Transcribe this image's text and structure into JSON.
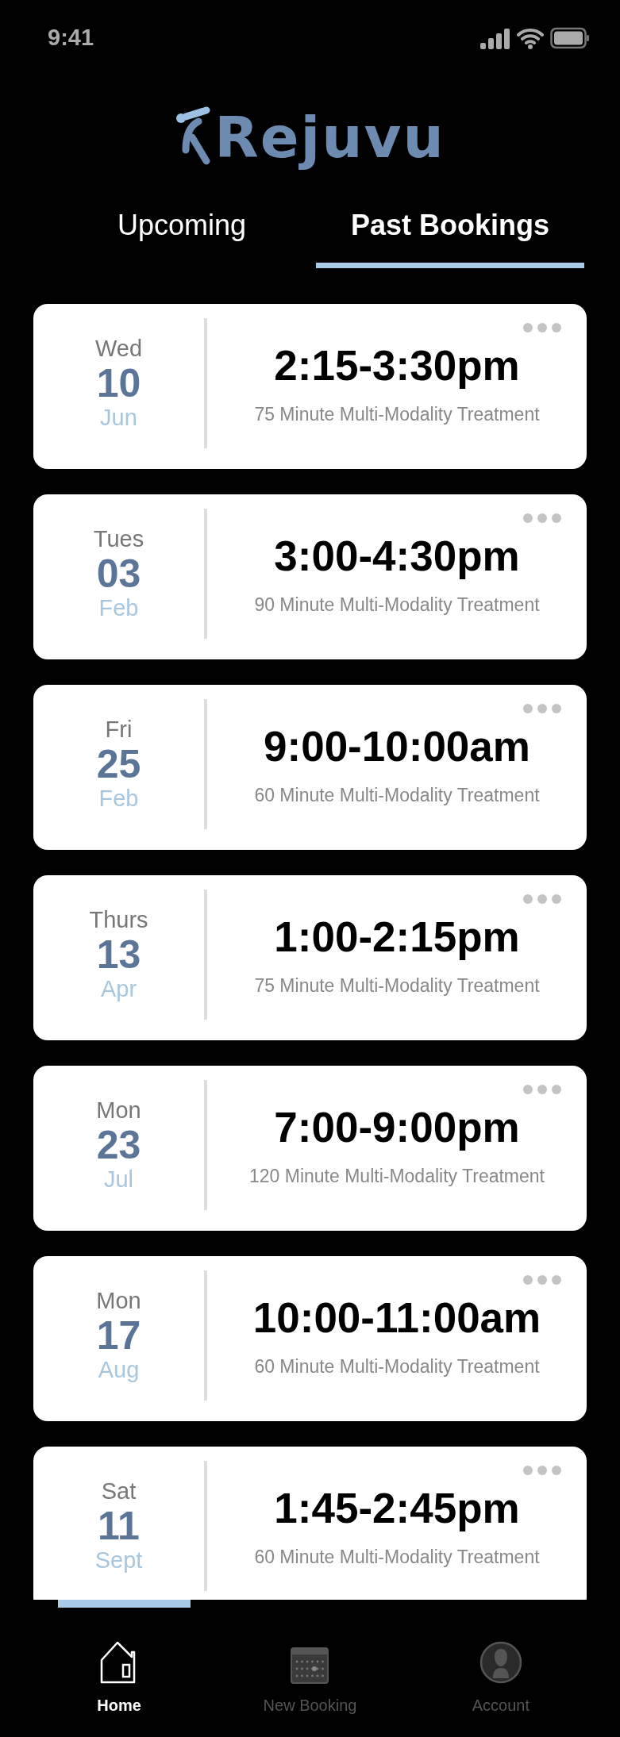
{
  "status_bar": {
    "time": "9:41"
  },
  "logo": {
    "text": "Rejuvu"
  },
  "tabs": [
    {
      "label": "Upcoming",
      "selected": false
    },
    {
      "label": "Past Bookings",
      "selected": true
    }
  ],
  "bookings": [
    {
      "day": "Wed",
      "date": "10",
      "month": "Jun",
      "time": "2:15-3:30pm",
      "treatment": "75 Minute Multi-Modality Treatment"
    },
    {
      "day": "Tues",
      "date": "03",
      "month": "Feb",
      "time": "3:00-4:30pm",
      "treatment": "90 Minute Multi-Modality Treatment"
    },
    {
      "day": "Fri",
      "date": "25",
      "month": "Feb",
      "time": "9:00-10:00am",
      "treatment": "60 Minute Multi-Modality Treatment"
    },
    {
      "day": "Thurs",
      "date": "13",
      "month": "Apr",
      "time": "1:00-2:15pm",
      "treatment": "75 Minute Multi-Modality Treatment"
    },
    {
      "day": "Mon",
      "date": "23",
      "month": "Jul",
      "time": "7:00-9:00pm",
      "treatment": "120 Minute Multi-Modality Treatment"
    },
    {
      "day": "Mon",
      "date": "17",
      "month": "Aug",
      "time": "10:00-11:00am",
      "treatment": "60 Minute Multi-Modality Treatment"
    },
    {
      "day": "Sat",
      "date": "11",
      "month": "Sept",
      "time": "1:45-2:45pm",
      "treatment": "60 Minute Multi-Modality Treatment"
    }
  ],
  "nav": [
    {
      "label": "Home",
      "kind": "home",
      "selected": true
    },
    {
      "label": "New Booking",
      "kind": "calendar",
      "selected": false
    },
    {
      "label": "Account",
      "kind": "account",
      "selected": false
    }
  ]
}
